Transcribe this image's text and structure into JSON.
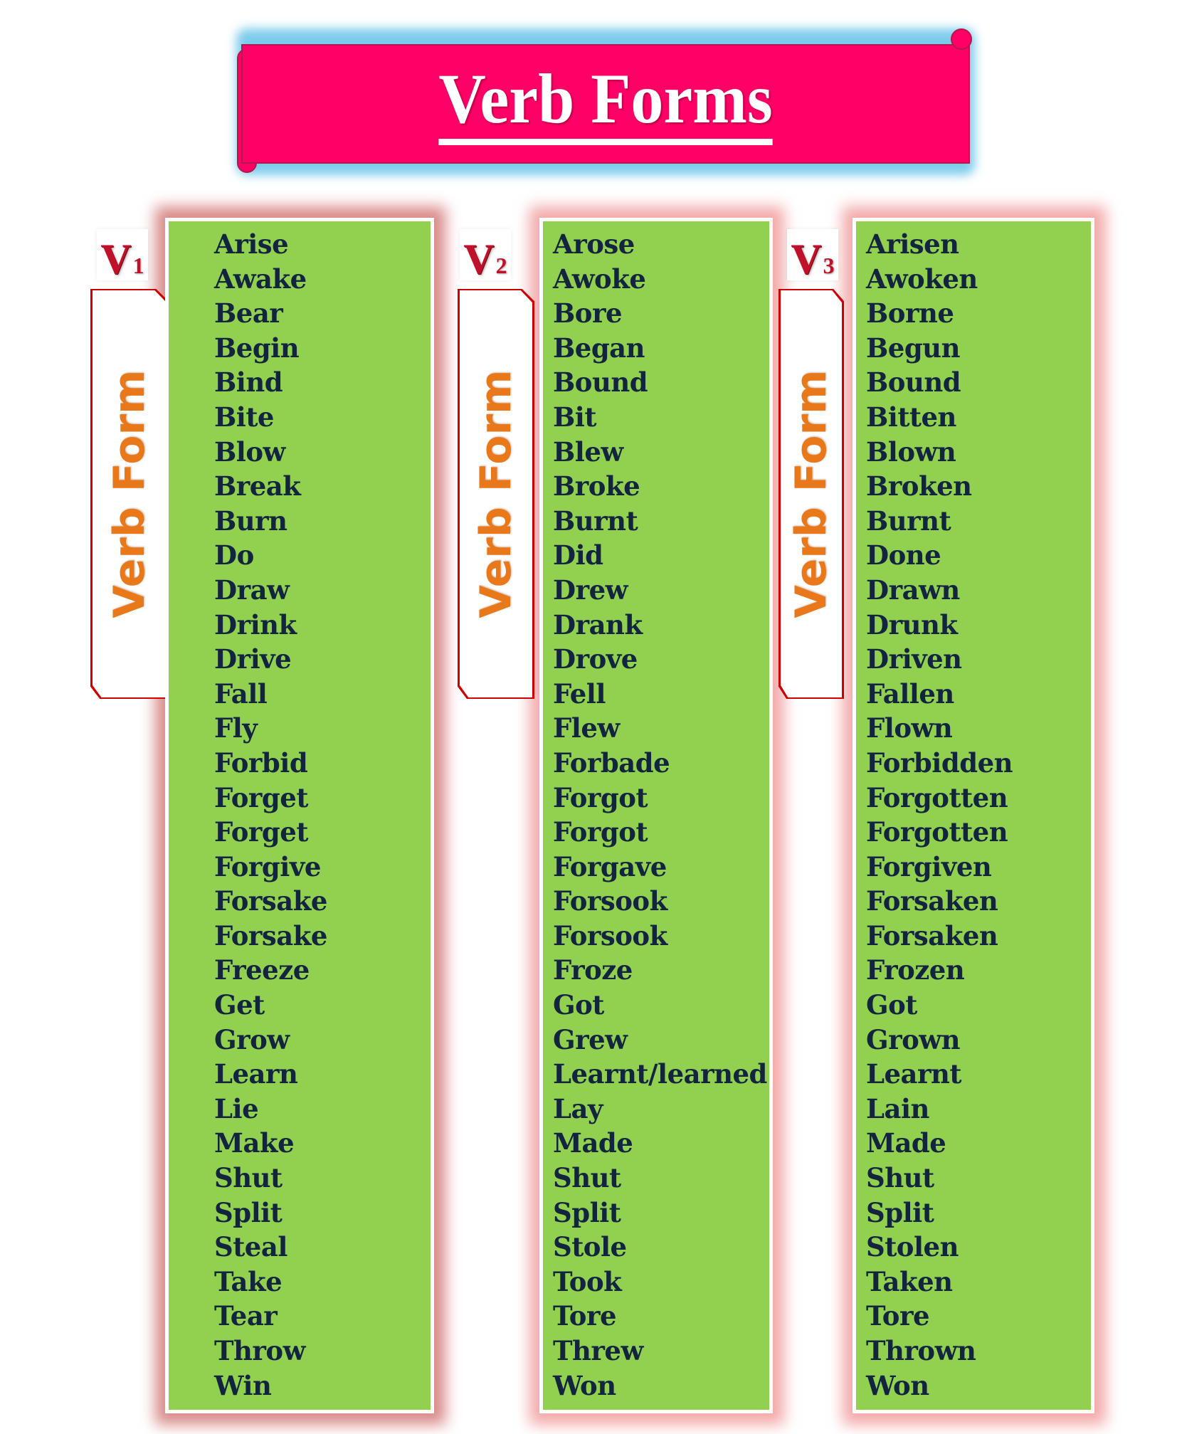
{
  "header": {
    "title": "Verb Forms"
  },
  "colors": {
    "banner": "#ff0066",
    "banner_glow": "#6fc6ea",
    "column_bg": "#92d050",
    "text": "#13243f",
    "tab_text": "#e8781a",
    "label_red": "#c0102a"
  },
  "columns": [
    {
      "label": "V",
      "subscript": "1",
      "tab_text": "Verb Form",
      "words": [
        "Arise",
        "Awake",
        "Bear",
        "Begin",
        "Bind",
        "Bite",
        "Blow",
        "Break",
        "Burn",
        "Do",
        "Draw",
        "Drink",
        "Drive",
        "Fall",
        "Fly",
        "Forbid",
        "Forget",
        "Forget",
        "Forgive",
        "Forsake",
        "Forsake",
        "Freeze",
        "Get",
        "Grow",
        "Learn",
        "Lie",
        "Make",
        "Shut",
        "Split",
        "Steal",
        "Take",
        "Tear",
        "Throw",
        "Win"
      ]
    },
    {
      "label": "V",
      "subscript": "2",
      "tab_text": "Verb Form",
      "words": [
        "Arose",
        "Awoke",
        "Bore",
        "Began",
        "Bound",
        "Bit",
        "Blew",
        "Broke",
        "Burnt",
        "Did",
        "Drew",
        "Drank",
        "Drove",
        "Fell",
        "Flew",
        "Forbade",
        "Forgot",
        "Forgot",
        "Forgave",
        "Forsook",
        "Forsook",
        "Froze",
        "Got",
        "Grew",
        "Learnt/learned",
        "Lay",
        "Made",
        "Shut",
        "Split",
        "Stole",
        "Took",
        "Tore",
        "Threw",
        "Won"
      ]
    },
    {
      "label": "V",
      "subscript": "3",
      "tab_text": "Verb Form",
      "words": [
        "Arisen",
        "Awoken",
        "Borne",
        "Begun",
        "Bound",
        "Bitten",
        "Blown",
        "Broken",
        "Burnt",
        "Done",
        "Drawn",
        "Drunk",
        "Driven",
        "Fallen",
        "Flown",
        "Forbidden",
        "Forgotten",
        "Forgotten",
        "Forgiven",
        "Forsaken",
        "Forsaken",
        "Frozen",
        "Got",
        "Grown",
        "Learnt",
        "Lain",
        "Made",
        "Shut",
        "Split",
        "Stolen",
        "Taken",
        "Tore",
        "Thrown",
        "Won"
      ]
    }
  ]
}
